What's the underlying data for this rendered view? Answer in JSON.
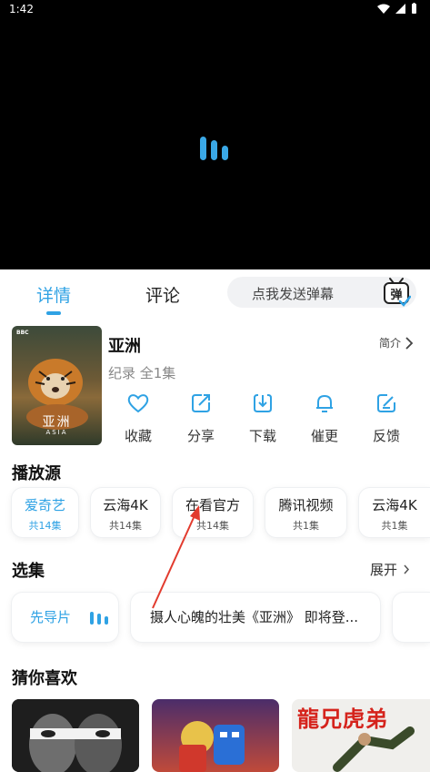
{
  "status_bar": {
    "time": "1:42"
  },
  "tabs": {
    "details": "详情",
    "comments": "评论"
  },
  "danmu": {
    "placeholder": "点我发送弹幕",
    "icon_char": "弹"
  },
  "show": {
    "title": "亚洲",
    "subtitle": "纪录 全1集",
    "intro_label": "简介",
    "poster_text": "亚洲",
    "poster_subtext": "ASIA",
    "poster_badge": "BBC"
  },
  "actions": [
    {
      "icon": "heart-icon",
      "label": "收藏"
    },
    {
      "icon": "share-icon",
      "label": "分享"
    },
    {
      "icon": "download-icon",
      "label": "下载"
    },
    {
      "icon": "bell-icon",
      "label": "催更"
    },
    {
      "icon": "feedback-icon",
      "label": "反馈"
    }
  ],
  "sources_title": "播放源",
  "sources": [
    {
      "name": "爱奇艺",
      "count": "共14集"
    },
    {
      "name": "云海4K",
      "count": "共14集"
    },
    {
      "name": "在看官方",
      "count": "共14集"
    },
    {
      "name": "腾讯视频",
      "count": "共1集"
    },
    {
      "name": "云海4K",
      "count": "共1集"
    }
  ],
  "episodes_title": "选集",
  "expand_label": "展开",
  "episodes": [
    {
      "label": "先导片"
    },
    {
      "label": "摄人心魄的壮美《亚洲》 即将登..."
    }
  ],
  "recommend_title": "猜你喜欢",
  "recommend_poster_text": "龍兄虎弟",
  "colors": {
    "accent": "#2fa2e4",
    "arrow": "#e23b2e"
  }
}
